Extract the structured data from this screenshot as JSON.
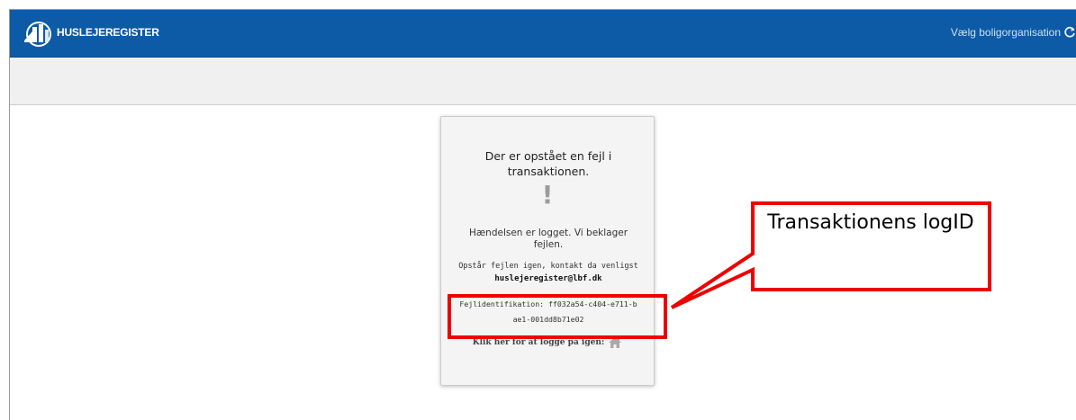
{
  "header": {
    "brand": "HUSLEJEREGISTER",
    "org_select_label": "Vælg boligorganisation",
    "header_color": "#0d5aa7"
  },
  "error_card": {
    "title": "Der er opstået en fejl i transaktionen.",
    "icon_symbol": "!",
    "logged_message": "Hændelsen er logget. Vi beklager fejlen.",
    "contact_text": "Opstår fejlen igen, kontakt da venligst",
    "contact_email": "huslejeregister@lbf.dk",
    "error_id_label": "Fejlidentifikation: ff032a54-c404-e711-bae1-001dd8b71e02",
    "relogin_label": "Klik her for at logge på igen:"
  },
  "annotation": {
    "callout_text": "Transaktionens logID",
    "annotation_color": "#ee0000"
  }
}
